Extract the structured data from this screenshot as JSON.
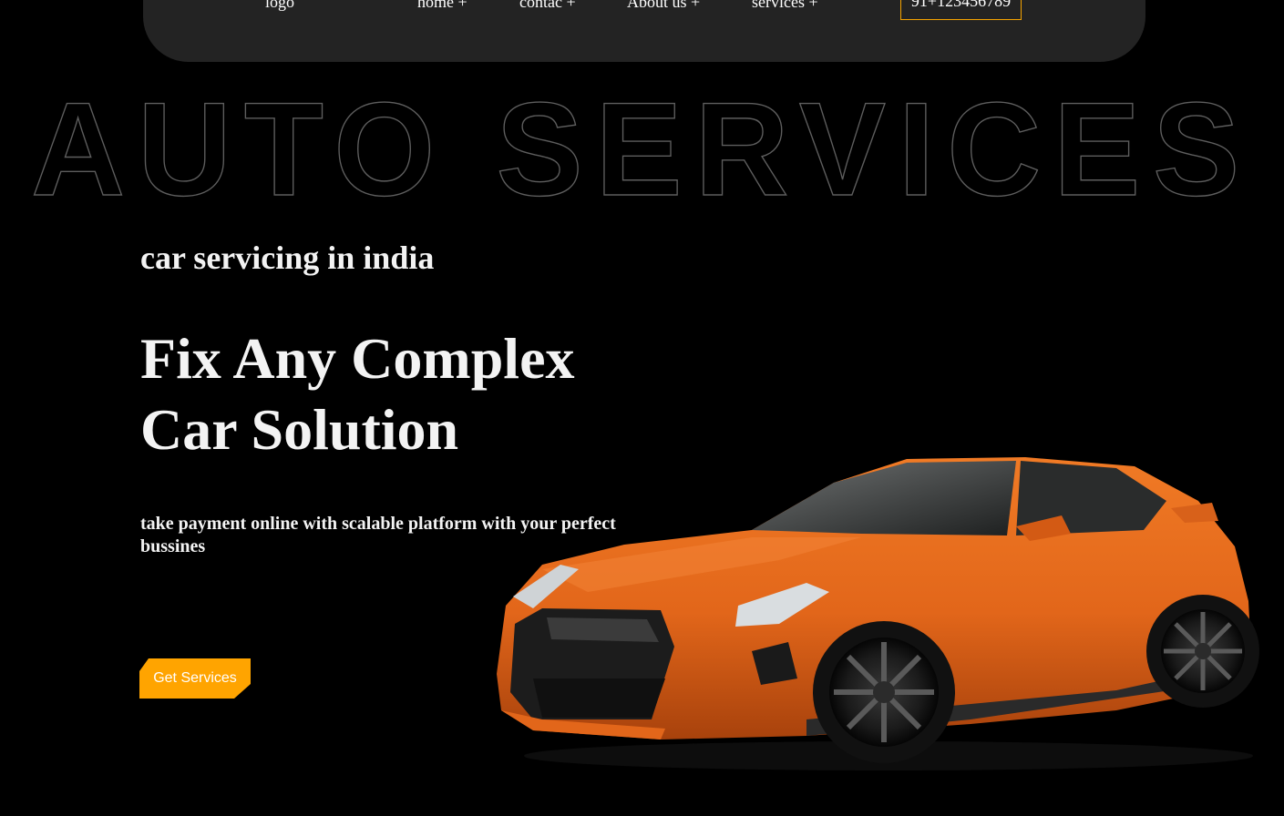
{
  "nav": {
    "logo": "logo",
    "items": [
      {
        "label": "home +"
      },
      {
        "label": "contac +"
      },
      {
        "label": "About us +"
      },
      {
        "label": "services +"
      }
    ],
    "phone": "91+123456789"
  },
  "hero": {
    "outline_title": "AUTO SERVICES",
    "tagline": "car servicing in india",
    "headline_line1": "Fix Any Complex",
    "headline_line2": "Car Solution",
    "subtext": "take payment online with scalable platform with your perfect bussines",
    "cta_label": "Get Services"
  },
  "colors": {
    "background": "#000000",
    "navbar": "#232323",
    "accent": "#ffa400",
    "text": "#f3f3f3",
    "outline": "#5e5e5e",
    "car_body": "#e2661a"
  },
  "icons": {
    "car": "orange-sports-car"
  }
}
